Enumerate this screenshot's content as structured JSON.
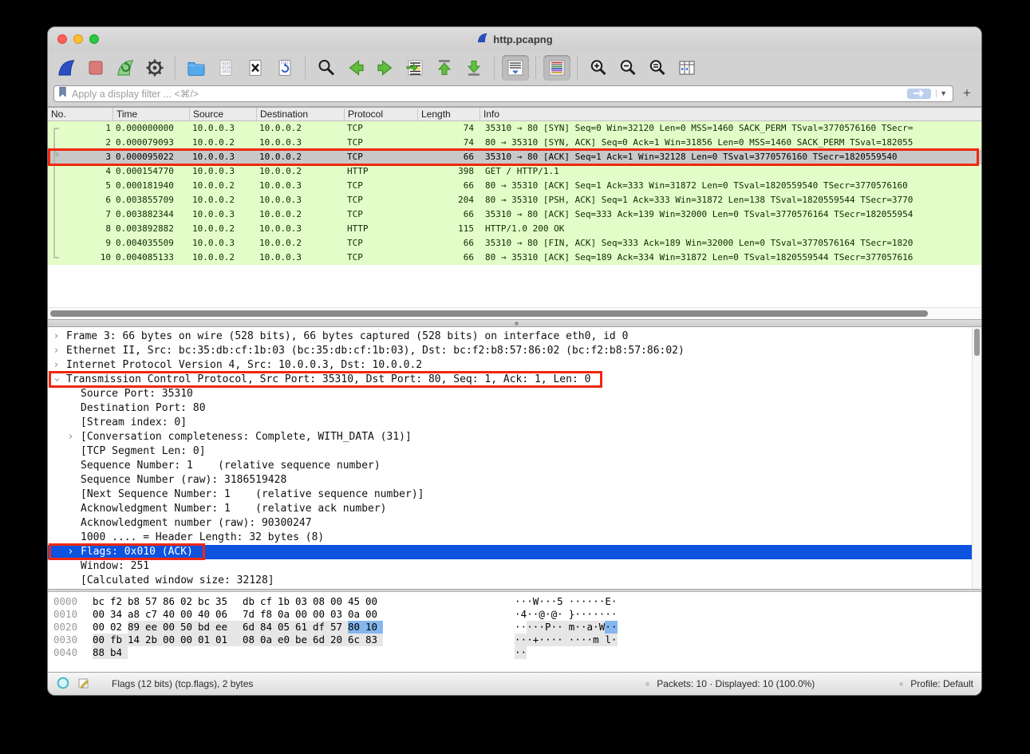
{
  "window": {
    "title": "http.pcapng"
  },
  "colors": {
    "packet_row_bg": "#e4fdc8",
    "selected_row_bg": "#c8c8c8",
    "selection_blue": "#0d53e0",
    "annotation_red": "#f0270f",
    "hex_field_highlight": "#85b6ee"
  },
  "toolbar": {
    "buttons": [
      {
        "icon": "fin_blue",
        "name": "start-capture"
      },
      {
        "icon": "stop",
        "name": "stop-capture"
      },
      {
        "icon": "fin_green",
        "name": "restart-capture"
      },
      {
        "icon": "gear",
        "name": "capture-options"
      },
      {
        "sep": true
      },
      {
        "icon": "folder",
        "name": "open-file"
      },
      {
        "icon": "doc_binary",
        "name": "save-file"
      },
      {
        "icon": "doc_x",
        "name": "close-file"
      },
      {
        "icon": "doc_reload",
        "name": "reload-file"
      },
      {
        "sep": true
      },
      {
        "icon": "find",
        "name": "find-packet"
      },
      {
        "icon": "arrow_left",
        "name": "go-back"
      },
      {
        "icon": "arrow_right",
        "name": "go-forward"
      },
      {
        "icon": "goto",
        "name": "go-to-packet"
      },
      {
        "icon": "go_top",
        "name": "go-first-packet"
      },
      {
        "icon": "go_bottom",
        "name": "go-last-packet"
      },
      {
        "sep": true
      },
      {
        "icon": "autoscroll",
        "name": "auto-scroll",
        "pressed": true
      },
      {
        "sep": true
      },
      {
        "icon": "colorize",
        "name": "colorize",
        "pressed": true
      },
      {
        "sep": true
      },
      {
        "icon": "zoom_in",
        "name": "zoom-in"
      },
      {
        "icon": "zoom_out",
        "name": "zoom-out"
      },
      {
        "icon": "zoom_eq",
        "name": "zoom-reset"
      },
      {
        "icon": "cols",
        "name": "resize-columns"
      }
    ]
  },
  "filter": {
    "placeholder": "Apply a display filter ... <⌘/>",
    "add_button": "+"
  },
  "packet_list": {
    "columns": [
      "No.",
      "Time",
      "Source",
      "Destination",
      "Protocol",
      "Length",
      "Info"
    ],
    "rows": [
      {
        "no": "1",
        "time": "0.000000000",
        "src": "10.0.0.3",
        "dst": "10.0.0.2",
        "proto": "TCP",
        "len": "74",
        "info": "35310 → 80 [SYN] Seq=0 Win=32120 Len=0 MSS=1460 SACK_PERM TSval=3770576160 TSecr=",
        "selected": false
      },
      {
        "no": "2",
        "time": "0.000079093",
        "src": "10.0.0.2",
        "dst": "10.0.0.3",
        "proto": "TCP",
        "len": "74",
        "info": "80 → 35310 [SYN, ACK] Seq=0 Ack=1 Win=31856 Len=0 MSS=1460 SACK_PERM TSval=182055",
        "selected": false
      },
      {
        "no": "3",
        "time": "0.000095022",
        "src": "10.0.0.3",
        "dst": "10.0.0.2",
        "proto": "TCP",
        "len": "66",
        "info": "35310 → 80 [ACK] Seq=1 Ack=1 Win=32128 Len=0 TSval=3770576160 TSecr=1820559540",
        "selected": true
      },
      {
        "no": "4",
        "time": "0.000154770",
        "src": "10.0.0.3",
        "dst": "10.0.0.2",
        "proto": "HTTP",
        "len": "398",
        "info": "GET / HTTP/1.1 ",
        "selected": false
      },
      {
        "no": "5",
        "time": "0.000181940",
        "src": "10.0.0.2",
        "dst": "10.0.0.3",
        "proto": "TCP",
        "len": "66",
        "info": "80 → 35310 [ACK] Seq=1 Ack=333 Win=31872 Len=0 TSval=1820559540 TSecr=3770576160",
        "selected": false
      },
      {
        "no": "6",
        "time": "0.003855709",
        "src": "10.0.0.2",
        "dst": "10.0.0.3",
        "proto": "TCP",
        "len": "204",
        "info": "80 → 35310 [PSH, ACK] Seq=1 Ack=333 Win=31872 Len=138 TSval=1820559544 TSecr=3770",
        "selected": false
      },
      {
        "no": "7",
        "time": "0.003882344",
        "src": "10.0.0.3",
        "dst": "10.0.0.2",
        "proto": "TCP",
        "len": "66",
        "info": "35310 → 80 [ACK] Seq=333 Ack=139 Win=32000 Len=0 TSval=3770576164 TSecr=182055954",
        "selected": false
      },
      {
        "no": "8",
        "time": "0.003892882",
        "src": "10.0.0.2",
        "dst": "10.0.0.3",
        "proto": "HTTP",
        "len": "115",
        "info": "HTTP/1.0 200 OK ",
        "selected": false
      },
      {
        "no": "9",
        "time": "0.004035509",
        "src": "10.0.0.3",
        "dst": "10.0.0.2",
        "proto": "TCP",
        "len": "66",
        "info": "35310 → 80 [FIN, ACK] Seq=333 Ack=189 Win=32000 Len=0 TSval=3770576164 TSecr=1820",
        "selected": false
      },
      {
        "no": "10",
        "time": "0.004085133",
        "src": "10.0.0.2",
        "dst": "10.0.0.3",
        "proto": "TCP",
        "len": "66",
        "info": "80 → 35310 [ACK] Seq=189 Ack=334 Win=31872 Len=0 TSval=1820559544 TSecr=377057616",
        "selected": false
      }
    ]
  },
  "details": {
    "lines": [
      {
        "text": "Frame 3: 66 bytes on wire (528 bits), 66 bytes captured (528 bits) on interface eth0, id 0",
        "chevron": "collapsed",
        "level": 0,
        "selected": false
      },
      {
        "text": "Ethernet II, Src: bc:35:db:cf:1b:03 (bc:35:db:cf:1b:03), Dst: bc:f2:b8:57:86:02 (bc:f2:b8:57:86:02)",
        "chevron": "collapsed",
        "level": 0,
        "selected": false
      },
      {
        "text": "Internet Protocol Version 4, Src: 10.0.0.3, Dst: 10.0.0.2",
        "chevron": "collapsed",
        "level": 0,
        "selected": false
      },
      {
        "text": "Transmission Control Protocol, Src Port: 35310, Dst Port: 80, Seq: 1, Ack: 1, Len: 0",
        "chevron": "expanded",
        "level": 0,
        "selected": false,
        "red_width": 694
      },
      {
        "text": "Source Port: 35310",
        "level": 1,
        "selected": false
      },
      {
        "text": "Destination Port: 80",
        "level": 1,
        "selected": false
      },
      {
        "text": "[Stream index: 0]",
        "level": 1,
        "selected": false
      },
      {
        "text": "[Conversation completeness: Complete, WITH_DATA (31)]",
        "chevron": "collapsed",
        "level": 1,
        "selected": false
      },
      {
        "text": "[TCP Segment Len: 0]",
        "level": 1,
        "selected": false
      },
      {
        "text": "Sequence Number: 1    (relative sequence number)",
        "level": 1,
        "selected": false
      },
      {
        "text": "Sequence Number (raw): 3186519428",
        "level": 1,
        "selected": false
      },
      {
        "text": "[Next Sequence Number: 1    (relative sequence number)]",
        "level": 1,
        "selected": false
      },
      {
        "text": "Acknowledgment Number: 1    (relative ack number)",
        "level": 1,
        "selected": false
      },
      {
        "text": "Acknowledgment number (raw): 90300247",
        "level": 1,
        "selected": false
      },
      {
        "text": "1000 .... = Header Length: 32 bytes (8)",
        "level": 1,
        "selected": false
      },
      {
        "text": "Flags: 0x010 (ACK)",
        "chevron": "collapsed",
        "level": 1,
        "selected": true,
        "red_width": 196
      },
      {
        "text": "Window: 251",
        "level": 1,
        "selected": false
      },
      {
        "text": "[Calculated window size: 32128]",
        "level": 1,
        "selected": false
      }
    ]
  },
  "hex": {
    "rows": [
      {
        "offset": "0000",
        "bytes": [
          "bc",
          "f2",
          "b8",
          "57",
          "86",
          "02",
          "bc",
          "35",
          "db",
          "cf",
          "1b",
          "03",
          "08",
          "00",
          "45",
          "00"
        ],
        "ascii": [
          "·",
          "·",
          "·",
          "W",
          "·",
          "·",
          "·",
          "5",
          "·",
          "·",
          "·",
          "·",
          "·",
          "·",
          "E",
          "·"
        ],
        "shade_start": null,
        "blue": []
      },
      {
        "offset": "0010",
        "bytes": [
          "00",
          "34",
          "a8",
          "c7",
          "40",
          "00",
          "40",
          "06",
          "7d",
          "f8",
          "0a",
          "00",
          "00",
          "03",
          "0a",
          "00"
        ],
        "ascii": [
          "·",
          "4",
          "·",
          "·",
          "@",
          "·",
          "@",
          "·",
          "}",
          "·",
          "·",
          "·",
          "·",
          "·",
          "·",
          "·"
        ],
        "shade_start": null,
        "blue": []
      },
      {
        "offset": "0020",
        "bytes": [
          "00",
          "02",
          "89",
          "ee",
          "00",
          "50",
          "bd",
          "ee",
          "6d",
          "84",
          "05",
          "61",
          "df",
          "57",
          "80",
          "10"
        ],
        "ascii": [
          "·",
          "·",
          "·",
          "·",
          "·",
          "P",
          "·",
          "·",
          "m",
          "·",
          "·",
          "a",
          "·",
          "W",
          "·",
          "·"
        ],
        "shade_start": 2,
        "blue": [
          14,
          15
        ]
      },
      {
        "offset": "0030",
        "bytes": [
          "00",
          "fb",
          "14",
          "2b",
          "00",
          "00",
          "01",
          "01",
          "08",
          "0a",
          "e0",
          "be",
          "6d",
          "20",
          "6c",
          "83"
        ],
        "ascii": [
          "·",
          "·",
          "·",
          "+",
          "·",
          "·",
          "·",
          "·",
          "·",
          "·",
          "·",
          "·",
          "m",
          " ",
          "l",
          "·"
        ],
        "shade_start": 0,
        "blue": []
      },
      {
        "offset": "0040",
        "bytes": [
          "88",
          "b4"
        ],
        "ascii": [
          "·",
          "·"
        ],
        "shade_start": 0,
        "blue": []
      }
    ]
  },
  "status_bar": {
    "field_info": "Flags (12 bits) (tcp.flags), 2 bytes",
    "packets": "Packets: 10 · Displayed: 10 (100.0%)",
    "profile": "Profile: Default"
  }
}
